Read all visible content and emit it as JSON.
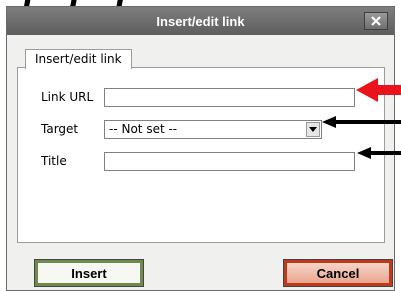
{
  "background_text": "l .  i   .  i",
  "dialog": {
    "title": "Insert/edit link",
    "tab_label": "Insert/edit link",
    "fields": {
      "link_url": {
        "label": "Link URL",
        "value": ""
      },
      "target": {
        "label": "Target",
        "selected": "-- Not set --"
      },
      "title": {
        "label": "Title",
        "value": ""
      }
    },
    "buttons": {
      "insert": "Insert",
      "cancel": "Cancel"
    }
  },
  "colors": {
    "titlebar": "#6b6b6b",
    "insert_border": "#6f8a4a",
    "cancel_border": "#c0391a",
    "red_arrow": "#e8131b",
    "black_arrow": "#000000"
  },
  "icons": {
    "close": "close-icon",
    "dropdown": "chevron-down-icon",
    "annotation_arrows": [
      "red-arrow-icon",
      "black-arrow-icon",
      "black-arrow-icon"
    ]
  }
}
